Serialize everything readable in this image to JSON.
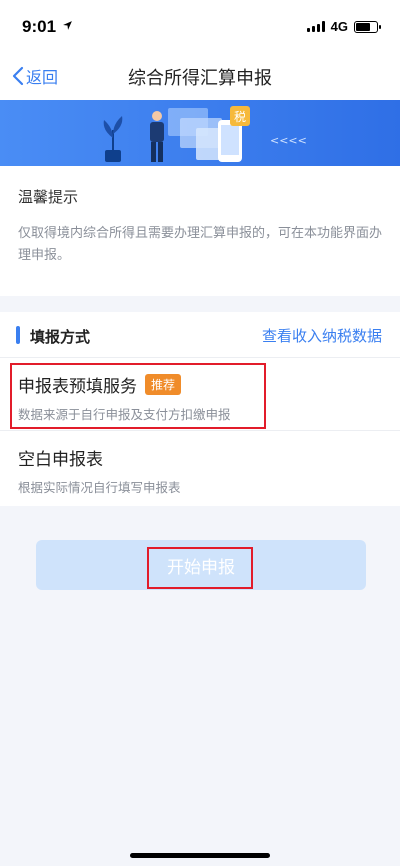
{
  "status_bar": {
    "time": "9:01",
    "network": "4G",
    "icons": [
      "location-arrow-icon",
      "signal-icon",
      "battery-icon"
    ]
  },
  "nav": {
    "back_label": "返回",
    "title": "综合所得汇算申报"
  },
  "banner": {
    "tax_badge": "税",
    "arrows": "<<<<"
  },
  "notice": {
    "title": "温馨提示",
    "text": "仅取得境内综合所得且需要办理汇算申报的，可在本功能界面办理申报。"
  },
  "filing_section": {
    "title": "填报方式",
    "link": "查看收入纳税数据",
    "options": [
      {
        "title": "申报表预填服务",
        "badge": "推荐",
        "subtitle": "数据来源于自行申报及支付方扣缴申报"
      },
      {
        "title": "空白申报表",
        "subtitle": "根据实际情况自行填写申报表"
      }
    ]
  },
  "start_button": {
    "label": "开始申报"
  },
  "colors": {
    "accent": "#3a7ff0",
    "badge": "#f08c2a",
    "highlight": "#e21c2a",
    "button_disabled": "#cfe3fb"
  }
}
